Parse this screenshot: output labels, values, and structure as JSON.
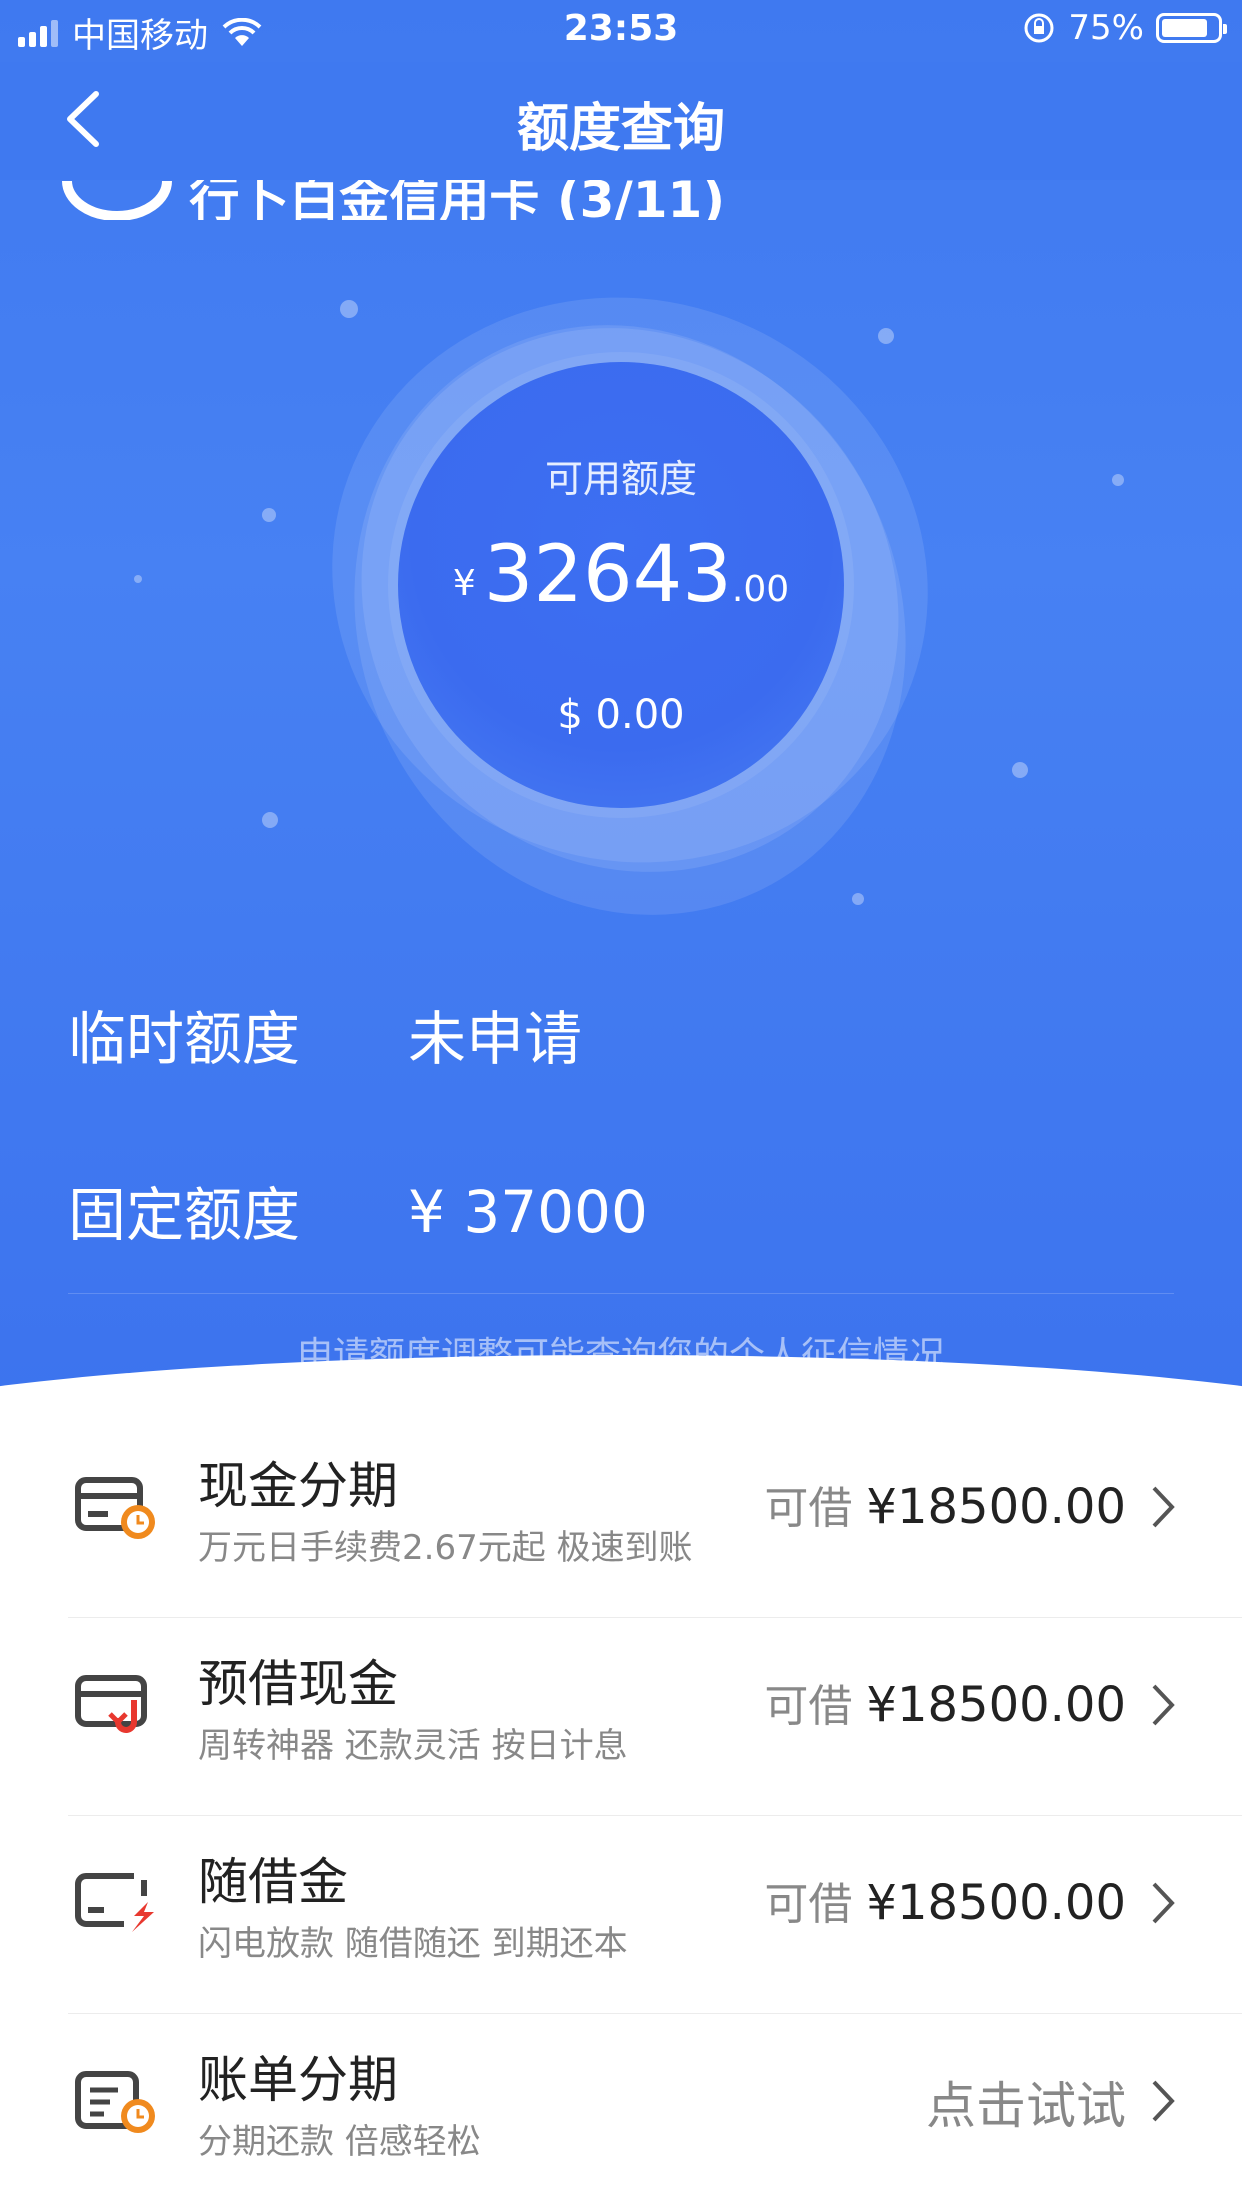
{
  "status_bar": {
    "carrier": "中国移动",
    "time": "23:53",
    "battery": "75%"
  },
  "nav": {
    "title": "额度查询",
    "card_name": "行卜白金信用卡 (3/11)"
  },
  "credit": {
    "available_label": "可用额度",
    "currency_symbol": "¥",
    "available_int": "32643",
    "available_dec": ".00",
    "usd": "$ 0.00"
  },
  "temp_limit": {
    "label": "临时额度",
    "value": "未申请"
  },
  "fixed_limit": {
    "label": "固定额度",
    "value": "¥ 37000"
  },
  "note": "申请额度调整可能查询您的个人征信情况",
  "items": [
    {
      "title": "现金分期",
      "sub": "万元日手续费2.67元起 极速到账",
      "prefix": "可借",
      "amount": "¥18500.00",
      "icon": "cash-installment-icon"
    },
    {
      "title": "预借现金",
      "sub": "周转神器 还款灵活 按日计息",
      "prefix": "可借",
      "amount": "¥18500.00",
      "icon": "cash-advance-icon"
    },
    {
      "title": "随借金",
      "sub": "闪电放款 随借随还 到期还本",
      "prefix": "可借",
      "amount": "¥18500.00",
      "icon": "flash-loan-icon"
    },
    {
      "title": "账单分期",
      "sub": "分期还款 倍感轻松",
      "prefix": "点击试试",
      "amount": "",
      "icon": "bill-installment-icon"
    }
  ],
  "colors": {
    "primary": "#3f79f0",
    "accent_orange": "#f08a1e",
    "accent_red": "#e8382f"
  }
}
